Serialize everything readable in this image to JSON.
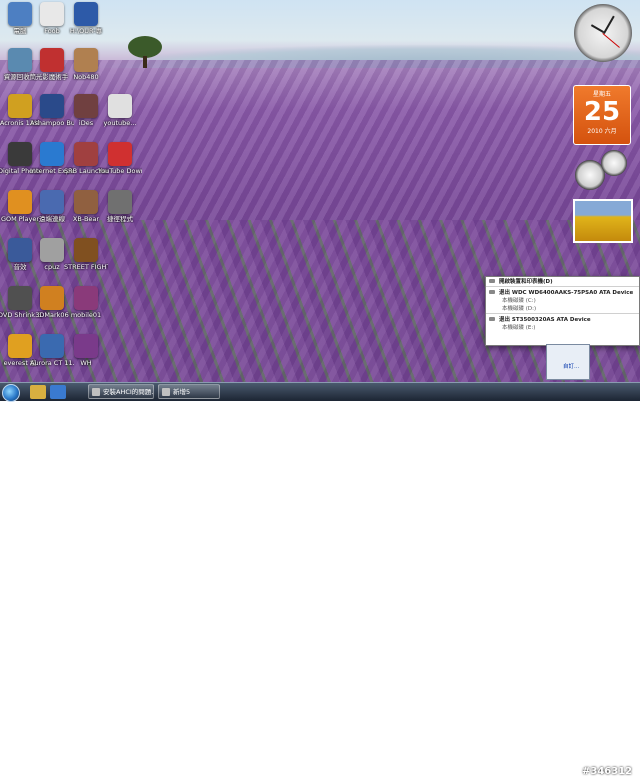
{
  "desktop_icons": [
    {
      "label": "電腦",
      "icon": "computer-icon",
      "color": "#4d7fc2"
    },
    {
      "label": "Foob",
      "icon": "document-icon",
      "color": "#e8e8e8"
    },
    {
      "label": "H:\\OUR-專",
      "icon": "drive-icon",
      "color": "#2d5aa8"
    },
    {
      "label": "資源回收筒",
      "icon": "recycle-bin-icon",
      "color": "#5a8ab0"
    },
    {
      "label": "光影魔術手",
      "icon": "camera-icon",
      "color": "#c03030"
    },
    {
      "label": "Nob480",
      "icon": "app-icon",
      "color": "#b08050"
    },
    {
      "label": "Acronis 13%",
      "icon": "acronis-icon",
      "color": "#d0a020"
    },
    {
      "label": "Ashampoo Burning...",
      "icon": "disc-icon",
      "color": "#2a4a8a"
    },
    {
      "label": "iDes",
      "icon": "app-icon",
      "color": "#704040"
    },
    {
      "label": "youtube...",
      "icon": "document-icon",
      "color": "#e0e0e0"
    },
    {
      "label": "Digital Photo Pro",
      "icon": "photo-icon",
      "color": "#3a3a3a"
    },
    {
      "label": "Internet Explorer",
      "icon": "ie-icon",
      "color": "#2a7ad0"
    },
    {
      "label": "SRB Launcher",
      "icon": "app-icon",
      "color": "#a04040"
    },
    {
      "label": "YouTube Download",
      "icon": "youtube-icon",
      "color": "#d03030"
    },
    {
      "label": "GOM Player",
      "icon": "player-icon",
      "color": "#e09020"
    },
    {
      "label": "遠端連線",
      "icon": "network-icon",
      "color": "#4a6ab0"
    },
    {
      "label": "XB-Bear",
      "icon": "app-icon",
      "color": "#906040"
    },
    {
      "label": "捷徑程式",
      "icon": "app-icon",
      "color": "#707070"
    },
    {
      "label": "音效",
      "icon": "speaker-icon",
      "color": "#3a5a9a"
    },
    {
      "label": "cpuz",
      "icon": "cpu-icon",
      "color": "#a0a0a0"
    },
    {
      "label": "STREET FIGHTER IV",
      "icon": "game-icon",
      "color": "#805020"
    },
    {
      "label": "DVD Shrink 3.2",
      "icon": "dvd-icon",
      "color": "#505050"
    },
    {
      "label": "3DMark06",
      "icon": "benchmark-icon",
      "color": "#d08020"
    },
    {
      "label": "mobile01",
      "icon": "winrar-icon",
      "color": "#8a3a7a"
    },
    {
      "label": "everest 編",
      "icon": "info-icon",
      "color": "#e0a020"
    },
    {
      "label": "Aurora CT 11.0",
      "icon": "app-icon",
      "color": "#3a6ab0"
    },
    {
      "label": "WH",
      "icon": "winrar-icon",
      "color": "#7a3a8a"
    }
  ],
  "calendar": {
    "weekday": "星期五",
    "day": "25",
    "year_month": "2010 六月"
  },
  "popup": {
    "title": "開啟裝置和印表機(D)",
    "devices": [
      {
        "name": "退出 WDC WD6400AAKS-75PSA0 ATA Device",
        "subs": [
          "本機磁碟 (C:)",
          "本機磁碟 (D:)"
        ]
      },
      {
        "name": "退出 ST3500320AS ATA Device",
        "subs": [
          "本機磁碟 (E:)"
        ]
      }
    ]
  },
  "notification": {
    "label": "自訂..."
  },
  "taskbar": {
    "tasks": [
      {
        "label": "安裝AHCI的問題..."
      },
      {
        "label": "新增5"
      }
    ]
  },
  "watermark": "#346312"
}
